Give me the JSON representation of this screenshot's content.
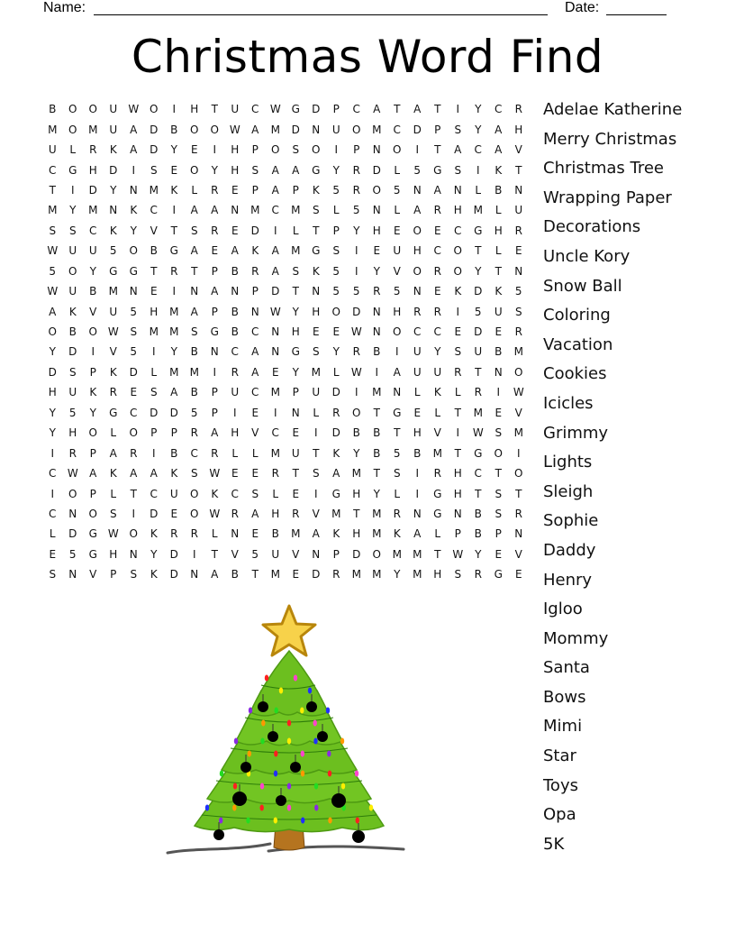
{
  "header": {
    "name_label": "Name:",
    "date_label": "Date:"
  },
  "title": "Christmas Word Find",
  "grid": [
    [
      "B",
      "O",
      "O",
      "U",
      "W",
      "O",
      "I",
      "H",
      "T",
      "U",
      "C",
      "W",
      "G",
      "D",
      "P",
      "C",
      "A",
      "T",
      "A",
      "T",
      "I",
      "Y",
      "C",
      "R"
    ],
    [
      "M",
      "O",
      "M",
      "U",
      "A",
      "D",
      "B",
      "O",
      "O",
      "W",
      "A",
      "M",
      "D",
      "N",
      "U",
      "O",
      "M",
      "C",
      "D",
      "P",
      "S",
      "Y",
      "A",
      "H"
    ],
    [
      "U",
      "L",
      "R",
      "K",
      "A",
      "D",
      "Y",
      "E",
      "I",
      "H",
      "P",
      "O",
      "S",
      "O",
      "I",
      "P",
      "N",
      "O",
      "I",
      "T",
      "A",
      "C",
      "A",
      "V"
    ],
    [
      "C",
      "G",
      "H",
      "D",
      "I",
      "S",
      "E",
      "O",
      "Y",
      "H",
      "S",
      "A",
      "A",
      "G",
      "Y",
      "R",
      "D",
      "L",
      "5",
      "G",
      "S",
      "I",
      "K",
      "T"
    ],
    [
      "T",
      "I",
      "D",
      "Y",
      "N",
      "M",
      "K",
      "L",
      "R",
      "E",
      "P",
      "A",
      "P",
      "K",
      "5",
      "R",
      "O",
      "5",
      "N",
      "A",
      "N",
      "L",
      "B",
      "N"
    ],
    [
      "M",
      "Y",
      "M",
      "N",
      "K",
      "C",
      "I",
      "A",
      "A",
      "N",
      "M",
      "C",
      "M",
      "S",
      "L",
      "5",
      "N",
      "L",
      "A",
      "R",
      "H",
      "M",
      "L",
      "U"
    ],
    [
      "S",
      "S",
      "C",
      "K",
      "Y",
      "V",
      "T",
      "S",
      "R",
      "E",
      "D",
      "I",
      "L",
      "T",
      "P",
      "Y",
      "H",
      "E",
      "O",
      "E",
      "C",
      "G",
      "H",
      "R"
    ],
    [
      "W",
      "U",
      "U",
      "5",
      "O",
      "B",
      "G",
      "A",
      "E",
      "A",
      "K",
      "A",
      "M",
      "G",
      "S",
      "I",
      "E",
      "U",
      "H",
      "C",
      "O",
      "T",
      "L",
      "E"
    ],
    [
      "5",
      "O",
      "Y",
      "G",
      "G",
      "T",
      "R",
      "T",
      "P",
      "B",
      "R",
      "A",
      "S",
      "K",
      "5",
      "I",
      "Y",
      "V",
      "O",
      "R",
      "O",
      "Y",
      "T",
      "N"
    ],
    [
      "W",
      "U",
      "B",
      "M",
      "N",
      "E",
      "I",
      "N",
      "A",
      "N",
      "P",
      "D",
      "T",
      "N",
      "5",
      "5",
      "R",
      "5",
      "N",
      "E",
      "K",
      "D",
      "K",
      "5"
    ],
    [
      "A",
      "K",
      "V",
      "U",
      "5",
      "H",
      "M",
      "A",
      "P",
      "B",
      "N",
      "W",
      "Y",
      "H",
      "O",
      "D",
      "N",
      "H",
      "R",
      "R",
      "I",
      "5",
      "U",
      "S"
    ],
    [
      "O",
      "B",
      "O",
      "W",
      "S",
      "M",
      "M",
      "S",
      "G",
      "B",
      "C",
      "N",
      "H",
      "E",
      "E",
      "W",
      "N",
      "O",
      "C",
      "C",
      "E",
      "D",
      "E",
      "R"
    ],
    [
      "Y",
      "D",
      "I",
      "V",
      "5",
      "I",
      "Y",
      "B",
      "N",
      "C",
      "A",
      "N",
      "G",
      "S",
      "Y",
      "R",
      "B",
      "I",
      "U",
      "Y",
      "S",
      "U",
      "B",
      "M"
    ],
    [
      "D",
      "S",
      "P",
      "K",
      "D",
      "L",
      "M",
      "M",
      "I",
      "R",
      "A",
      "E",
      "Y",
      "M",
      "L",
      "W",
      "I",
      "A",
      "U",
      "U",
      "R",
      "T",
      "N",
      "O"
    ],
    [
      "H",
      "U",
      "K",
      "R",
      "E",
      "S",
      "A",
      "B",
      "P",
      "U",
      "C",
      "M",
      "P",
      "U",
      "D",
      "I",
      "M",
      "N",
      "L",
      "K",
      "L",
      "R",
      "I",
      "W"
    ],
    [
      "Y",
      "5",
      "Y",
      "G",
      "C",
      "D",
      "D",
      "5",
      "P",
      "I",
      "E",
      "I",
      "N",
      "L",
      "R",
      "O",
      "T",
      "G",
      "E",
      "L",
      "T",
      "M",
      "E",
      "V"
    ],
    [
      "Y",
      "H",
      "O",
      "L",
      "O",
      "P",
      "P",
      "R",
      "A",
      "H",
      "V",
      "C",
      "E",
      "I",
      "D",
      "B",
      "B",
      "T",
      "H",
      "V",
      "I",
      "W",
      "S",
      "M"
    ],
    [
      "I",
      "R",
      "P",
      "A",
      "R",
      "I",
      "B",
      "C",
      "R",
      "L",
      "L",
      "M",
      "U",
      "T",
      "K",
      "Y",
      "B",
      "5",
      "B",
      "M",
      "T",
      "G",
      "O",
      "I"
    ],
    [
      "C",
      "W",
      "A",
      "K",
      "A",
      "A",
      "K",
      "S",
      "W",
      "E",
      "E",
      "R",
      "T",
      "S",
      "A",
      "M",
      "T",
      "S",
      "I",
      "R",
      "H",
      "C",
      "T",
      "O"
    ],
    [
      "I",
      "O",
      "P",
      "L",
      "T",
      "C",
      "U",
      "O",
      "K",
      "C",
      "S",
      "L",
      "E",
      "I",
      "G",
      "H",
      "Y",
      "L",
      "I",
      "G",
      "H",
      "T",
      "S",
      "T"
    ],
    [
      "C",
      "N",
      "O",
      "S",
      "I",
      "D",
      "E",
      "O",
      "W",
      "R",
      "A",
      "H",
      "R",
      "V",
      "M",
      "T",
      "M",
      "R",
      "N",
      "G",
      "N",
      "B",
      "S",
      "R"
    ],
    [
      "L",
      "D",
      "G",
      "W",
      "O",
      "K",
      "R",
      "R",
      "L",
      "N",
      "E",
      "B",
      "M",
      "A",
      "K",
      "H",
      "M",
      "K",
      "A",
      "L",
      "P",
      "B",
      "P",
      "N"
    ],
    [
      "E",
      "5",
      "G",
      "H",
      "N",
      "Y",
      "D",
      "I",
      "T",
      "V",
      "5",
      "U",
      "V",
      "N",
      "P",
      "D",
      "O",
      "M",
      "M",
      "T",
      "W",
      "Y",
      "E",
      "V"
    ],
    [
      "S",
      "N",
      "V",
      "P",
      "S",
      "K",
      "D",
      "N",
      "A",
      "B",
      "T",
      "M",
      "E",
      "D",
      "R",
      "M",
      "M",
      "Y",
      "M",
      "H",
      "S",
      "R",
      "G",
      "E"
    ]
  ],
  "words": [
    "Adelae Katherine",
    "Merry Christmas",
    "Christmas Tree",
    "Wrapping Paper",
    "Decorations",
    "Uncle Kory",
    "Snow Ball",
    "Coloring",
    "Vacation",
    "Cookies",
    "Icicles",
    "Grimmy",
    "Lights",
    "Sleigh",
    "Sophie",
    "Daddy",
    "Henry",
    "Igloo",
    "Mommy",
    "Santa",
    "Bows",
    "Mimi",
    "Star",
    "Toys",
    "Opa",
    "5K"
  ],
  "illustration": {
    "subject": "christmas-tree",
    "colors": {
      "foliage": "#6cbf1f",
      "foliage_dark": "#4e9a12",
      "star": "#f7d24a",
      "star_outline": "#b8860b",
      "trunk": "#b5741f",
      "ornament": "#000000",
      "light_colors": [
        "#ff2020",
        "#ffee00",
        "#ff44cc",
        "#2030ff",
        "#8a2be2",
        "#ff9900",
        "#22dd22"
      ]
    }
  }
}
